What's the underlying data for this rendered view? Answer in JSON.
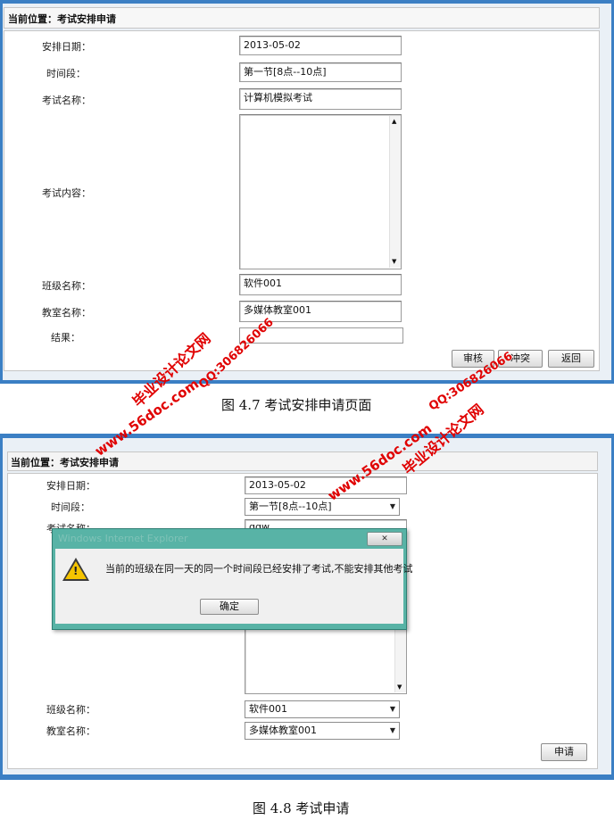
{
  "fig1": {
    "location_title": "当前位置：考试安排申请",
    "labels": {
      "date": "安排日期：",
      "period": "时间段：",
      "exam_name": "考试名称：",
      "exam_content": "考试内容：",
      "class_name": "班级名称：",
      "room_name": "教室名称：",
      "result": "结果："
    },
    "values": {
      "date": "2013-05-02",
      "period": "第一节[8点--10点]",
      "exam_name": "计算机模拟考试",
      "class_name": "软件001",
      "room_name": "多媒体教室001"
    },
    "buttons": {
      "review": "审核",
      "conflict": "冲突",
      "back": "返回"
    },
    "caption": "图 4.7  考试安排申请页面"
  },
  "fig2": {
    "location_title": "当前位置：考试安排申请",
    "labels": {
      "date": "安排日期：",
      "period": "时间段：",
      "exam_name": "考试名称：",
      "class_name": "班级名称：",
      "room_name": "教室名称："
    },
    "values": {
      "date": "2013-05-02",
      "period": "第一节[8点--10点]",
      "exam_name": "qqw",
      "class_name": "软件001",
      "room_name": "多媒体教室001"
    },
    "dialog": {
      "title": "Windows Internet Explorer",
      "message": "当前的班级在同一天的同一个时间段已经安排了考试,不能安排其他考试",
      "ok_label": "确定",
      "close_glyph": "✕",
      "warning_glyph": "!"
    },
    "buttons": {
      "apply": "申请"
    },
    "caption": "图 4.8  考试申请"
  },
  "watermarks": {
    "site_top": "毕业设计论文网",
    "qq_top": "QQ:306826066",
    "url_top": "www.56doc.com",
    "qq_mid": "QQ:306826066",
    "url_mid": "www.56doc.com",
    "site_mid": "毕业设计论文网"
  },
  "icons": {
    "scroll_up": "scroll-up-arrow-icon",
    "scroll_down": "scroll-down-arrow-icon",
    "dropdown": "chevron-down-icon",
    "warning": "warning-triangle-icon",
    "close": "close-icon"
  },
  "colors": {
    "frame_blue": "#3b7fc4",
    "dialog_teal": "#4aa79b",
    "watermark_red": "#e00000",
    "warning_yellow": "#f5c400"
  }
}
